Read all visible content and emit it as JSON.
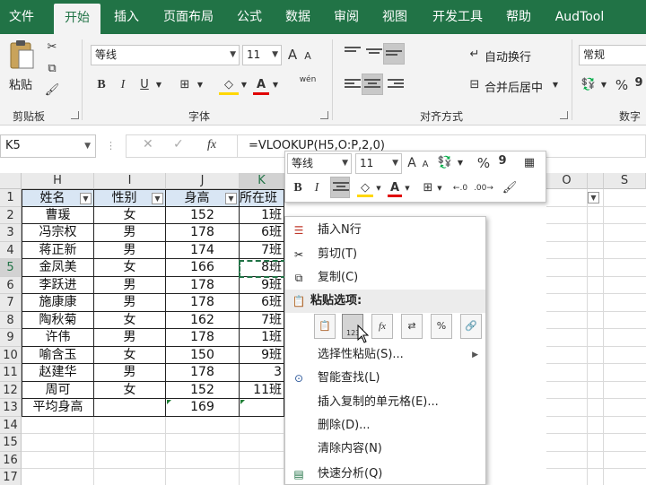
{
  "tabs": [
    "文件",
    "开始",
    "插入",
    "页面布局",
    "公式",
    "数据",
    "审阅",
    "视图",
    "开发工具",
    "帮助",
    "AudTool"
  ],
  "active_tab": "开始",
  "ribbon": {
    "clipboard": {
      "paste": "粘贴",
      "label": "剪贴板"
    },
    "font": {
      "name": "等线",
      "size": "11",
      "grow": "A",
      "shrink": "A",
      "phonetic": "wén",
      "bold": "B",
      "italic": "I",
      "underline": "U",
      "label": "字体"
    },
    "alignment": {
      "wrap": "自动换行",
      "merge": "合并后居中",
      "label": "对齐方式"
    },
    "number": {
      "format": "常规",
      "percent": "%",
      "comma": "9",
      "label": "数字"
    }
  },
  "formula_bar": {
    "name_box": "K5",
    "fx": "fx",
    "formula": "=VLOOKUP(H5,O:P,2,0)"
  },
  "columns": [
    "H",
    "I",
    "J",
    "K",
    "O",
    "S"
  ],
  "rows": [
    "1",
    "2",
    "3",
    "4",
    "5",
    "6",
    "7",
    "8",
    "9",
    "10",
    "11",
    "12",
    "13",
    "14",
    "15",
    "16",
    "17"
  ],
  "table": {
    "headers": [
      "姓名",
      "性别",
      "身高",
      "所在班"
    ],
    "records": [
      [
        "曹瑗",
        "女",
        "152",
        "1班"
      ],
      [
        "冯宗权",
        "男",
        "178",
        "6班"
      ],
      [
        "蒋正新",
        "男",
        "174",
        "7班"
      ],
      [
        "金凤美",
        "女",
        "166",
        "8班"
      ],
      [
        "李跃进",
        "男",
        "178",
        "9班"
      ],
      [
        "施康康",
        "男",
        "178",
        "6班"
      ],
      [
        "陶秋菊",
        "女",
        "162",
        "7班"
      ],
      [
        "许伟",
        "男",
        "178",
        "1班"
      ],
      [
        "喻含玉",
        "女",
        "150",
        "9班"
      ],
      [
        "赵建华",
        "男",
        "178",
        "3"
      ],
      [
        "周可",
        "女",
        "152",
        "11班"
      ]
    ],
    "summary": {
      "label": "平均身高",
      "value": "169"
    }
  },
  "mini_toolbar": {
    "font": "等线",
    "size": "11",
    "percent": "%",
    "comma": "9",
    "bold": "B",
    "italic": "I"
  },
  "context_menu": {
    "items": [
      "插入N行",
      "剪切(T)",
      "复制(C)"
    ],
    "paste_group": "粘贴选项:",
    "paste_badge": "123",
    "items2": [
      "选择性粘贴(S)...",
      "智能查找(L)",
      "插入复制的单元格(E)...",
      "删除(D)...",
      "清除内容(N)",
      "快速分析(Q)"
    ]
  },
  "colors": {
    "accent": "#217346",
    "header_fill": "#d9e6f4"
  }
}
